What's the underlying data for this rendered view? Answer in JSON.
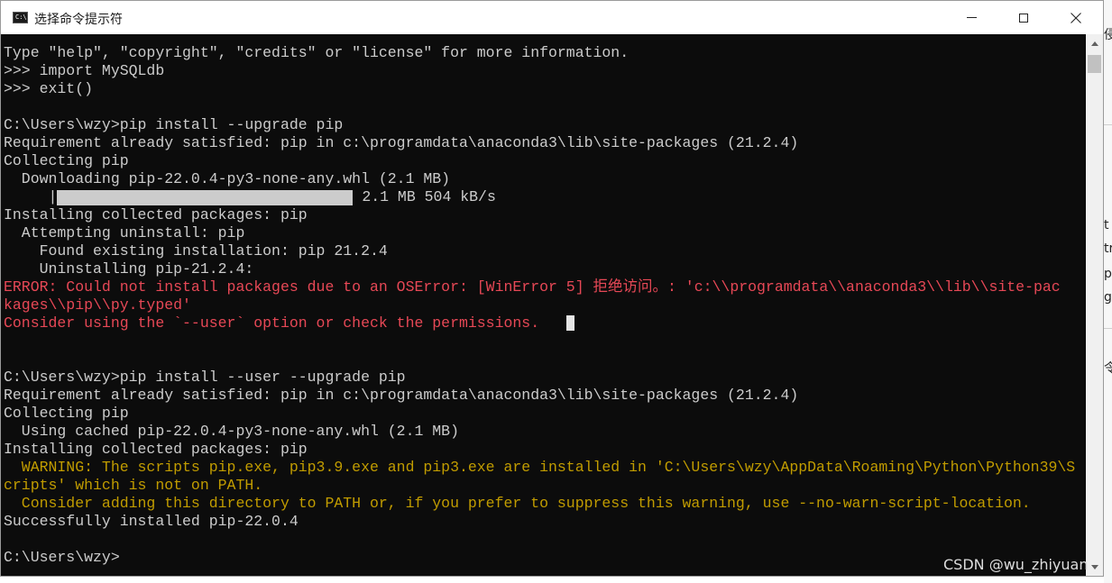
{
  "window": {
    "title": "选择命令提示符",
    "icon_text": "C:\\"
  },
  "background_window": {
    "fragments": [
      "侵",
      "t",
      "tr",
      "p",
      "g",
      "令"
    ]
  },
  "console": {
    "lines": [
      {
        "text": "Type \"help\", \"copyright\", \"credits\" or \"license\" for more information.",
        "kind": "default"
      },
      {
        "text": ">>> import MySQLdb",
        "kind": "default"
      },
      {
        "text": ">>> exit()",
        "kind": "default"
      },
      {
        "text": "",
        "kind": "default"
      },
      {
        "text": "C:\\Users\\wzy>pip install --upgrade pip",
        "kind": "default"
      },
      {
        "text": "Requirement already satisfied: pip in c:\\programdata\\anaconda3\\lib\\site-packages (21.2.4)",
        "kind": "default"
      },
      {
        "text": "Collecting pip",
        "kind": "default"
      },
      {
        "text": "  Downloading pip-22.0.4-py3-none-any.whl (2.1 MB)",
        "kind": "default"
      },
      {
        "text": "PROGRESS",
        "kind": "progress"
      },
      {
        "text": "Installing collected packages: pip",
        "kind": "default"
      },
      {
        "text": "  Attempting uninstall: pip",
        "kind": "default"
      },
      {
        "text": "    Found existing installation: pip 21.2.4",
        "kind": "default"
      },
      {
        "text": "    Uninstalling pip-21.2.4:",
        "kind": "default"
      },
      {
        "text": "ERROR: Could not install packages due to an OSError: [WinError 5] 拒绝访问。: 'c:\\\\programdata\\\\anaconda3\\\\lib\\\\site-pac",
        "kind": "error"
      },
      {
        "text": "kages\\\\pip\\\\py.typed'",
        "kind": "error"
      },
      {
        "text": "Consider using the `--user` option or check the permissions.",
        "kind": "error",
        "cursor": true
      },
      {
        "text": "",
        "kind": "default"
      },
      {
        "text": "",
        "kind": "default"
      },
      {
        "text": "C:\\Users\\wzy>pip install --user --upgrade pip",
        "kind": "default"
      },
      {
        "text": "Requirement already satisfied: pip in c:\\programdata\\anaconda3\\lib\\site-packages (21.2.4)",
        "kind": "default"
      },
      {
        "text": "Collecting pip",
        "kind": "default"
      },
      {
        "text": "  Using cached pip-22.0.4-py3-none-any.whl (2.1 MB)",
        "kind": "default"
      },
      {
        "text": "Installing collected packages: pip",
        "kind": "default"
      },
      {
        "text": "  WARNING: The scripts pip.exe, pip3.9.exe and pip3.exe are installed in 'C:\\Users\\wzy\\AppData\\Roaming\\Python\\Python39\\S",
        "kind": "warning"
      },
      {
        "text": "cripts' which is not on PATH.",
        "kind": "warning"
      },
      {
        "text": "  Consider adding this directory to PATH or, if you prefer to suppress this warning, use --no-warn-script-location.",
        "kind": "warning"
      },
      {
        "text": "Successfully installed pip-22.0.4",
        "kind": "default"
      },
      {
        "text": "",
        "kind": "default"
      },
      {
        "text": "C:\\Users\\wzy>",
        "kind": "default"
      }
    ],
    "progress": {
      "prefix": "     |",
      "fraction": 1.0,
      "suffix": " 2.1 MB 504 kB/s"
    }
  },
  "watermark": "CSDN @wu_zhiyuan",
  "colors": {
    "console_bg": "#0c0c0c",
    "default_text": "#cccccc",
    "error_text": "#e74856",
    "warning_text": "#c19c00"
  }
}
